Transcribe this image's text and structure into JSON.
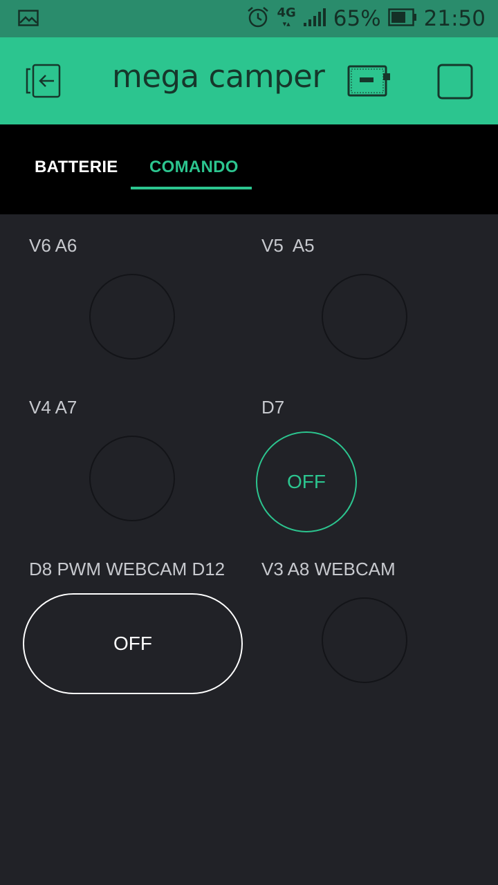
{
  "status_bar": {
    "battery_percent": "65%",
    "time": "21:50",
    "network": "4G",
    "icons": [
      "gallery-icon",
      "alarm-icon",
      "signal-icon",
      "battery-icon"
    ]
  },
  "app_bar": {
    "title": "mega camper",
    "icons": [
      "exit-icon",
      "device-board-icon",
      "stop-icon"
    ]
  },
  "tabs": [
    {
      "label": "BATTERIE",
      "active": false
    },
    {
      "label": "COMANDO",
      "active": true
    }
  ],
  "widgets": [
    {
      "label": "V6 A6"
    },
    {
      "label": "V5  A5"
    },
    {
      "label": "V4 A7"
    },
    {
      "label": "D7",
      "button_text": "OFF"
    },
    {
      "label": "D8 PWM WEBCAM D12",
      "button_text": "OFF"
    },
    {
      "label": "V3 A8 WEBCAM"
    }
  ],
  "colors": {
    "accent": "#2cc58f",
    "status_bar": "#2a8c6c",
    "background": "#212227",
    "tab_bar": "#000000"
  }
}
